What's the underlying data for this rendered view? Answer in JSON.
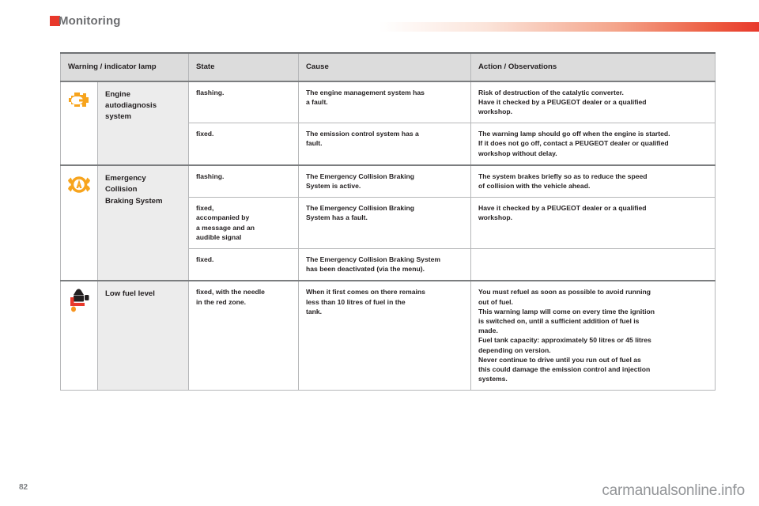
{
  "header": {
    "section_title": "Monitoring",
    "marker_color": "#e8382b",
    "rule_gradient_end": "#e8382b"
  },
  "table": {
    "columns": [
      "Warning / indicator lamp",
      "State",
      "Cause",
      "Action / Observations"
    ],
    "rows": [
      {
        "icon": "engine-autodiagnosis-icon",
        "icon_color": "#f7a41d",
        "lamp_name": "Engine autodiagnosis system",
        "lamp_name_lines": [
          "Engine",
          "autodiagnosis",
          "system"
        ],
        "states": [
          {
            "state": "flashing.",
            "state_lines": [
              "flashing."
            ],
            "cause": "The engine management system has a fault.",
            "cause_lines": [
              "The engine management system has",
              "a fault."
            ],
            "action": "Risk of destruction of the catalytic converter. Have it checked by a PEUGEOT dealer or a qualified workshop.",
            "action_lines": [
              "Risk of destruction of the catalytic converter.",
              "Have it checked by a PEUGEOT dealer or a qualified",
              "workshop."
            ]
          },
          {
            "state": "fixed.",
            "state_lines": [
              "fixed."
            ],
            "cause": "The emission control system has a fault.",
            "cause_lines": [
              "The emission control system has a",
              "fault."
            ],
            "action": "The warning lamp should go off when the engine is started. If it does not go off, contact a PEUGEOT dealer or qualified workshop without delay.",
            "action_lines": [
              "The warning lamp should go off when the engine is started.",
              "If it does not go off, contact a PEUGEOT dealer or qualified",
              "workshop without delay."
            ]
          }
        ]
      },
      {
        "icon": "emergency-collision-braking-icon",
        "icon_color": "#f7a41d",
        "lamp_name": "Emergency Collision Braking System",
        "lamp_name_lines": [
          "Emergency",
          "Collision",
          "Braking System"
        ],
        "states": [
          {
            "state": "flashing.",
            "state_lines": [
              "flashing."
            ],
            "cause": "The Emergency Collision Braking System is active.",
            "cause_lines": [
              "The Emergency Collision Braking",
              "System is active."
            ],
            "action": "The system brakes briefly so as to reduce the speed of collision with the vehicle ahead.",
            "action_lines": [
              "The system brakes briefly so as to reduce the speed",
              "of collision with the vehicle ahead."
            ]
          },
          {
            "state": "fixed, accompanied by a message and an audible signal",
            "state_lines": [
              "fixed,",
              "accompanied by",
              "a message and an",
              "audible signal"
            ],
            "cause": "The Emergency Collision Braking System has a fault.",
            "cause_lines": [
              "The Emergency Collision Braking",
              "System has a fault."
            ],
            "action": "Have it checked by a PEUGEOT dealer or a qualified workshop.",
            "action_lines": [
              "Have it checked by a PEUGEOT dealer or a qualified",
              "workshop."
            ]
          },
          {
            "state": "fixed.",
            "state_lines": [
              "fixed."
            ],
            "cause": "The Emergency Collision Braking System has been deactivated (via the menu).",
            "cause_lines": [
              "The Emergency Collision Braking System",
              "has been deactivated (via the menu)."
            ],
            "action": "",
            "action_lines": []
          }
        ]
      },
      {
        "icon": "low-fuel-level-icon",
        "icon_color": "#e8382b",
        "lamp_name": "Low fuel level",
        "lamp_name_lines": [
          "Low fuel level"
        ],
        "states": [
          {
            "state": "fixed, with the needle in the red zone.",
            "state_lines": [
              "fixed, with the needle",
              "in the red zone."
            ],
            "cause": "When it first comes on there remains less than 10 litres of fuel in the tank.",
            "cause_lines": [
              "When it first comes on there remains",
              "less than 10 litres of fuel in the",
              "tank."
            ],
            "action": "You must refuel as soon as possible to avoid running out of fuel. This warning lamp will come on every time the ignition is switched on, until a sufficient addition of fuel is made. Fuel tank capacity: approximately 50 litres or 45 litres depending on version. Never continue to drive until you run out of fuel as this could damage the emission control and injection systems.",
            "action_lines": [
              "You must refuel as soon as possible to avoid running",
              "out of fuel.",
              "This warning lamp will come on every time the ignition",
              "is switched on, until a sufficient addition of fuel is",
              "made.",
              "Fuel tank capacity: approximately 50 litres or 45 litres",
              "depending on version.",
              "Never continue to drive until you run out of fuel as",
              "this could damage the emission control and injection",
              "systems."
            ]
          }
        ]
      }
    ]
  },
  "footer": {
    "page_number": "82",
    "watermark": "carmanualsonline.info"
  }
}
